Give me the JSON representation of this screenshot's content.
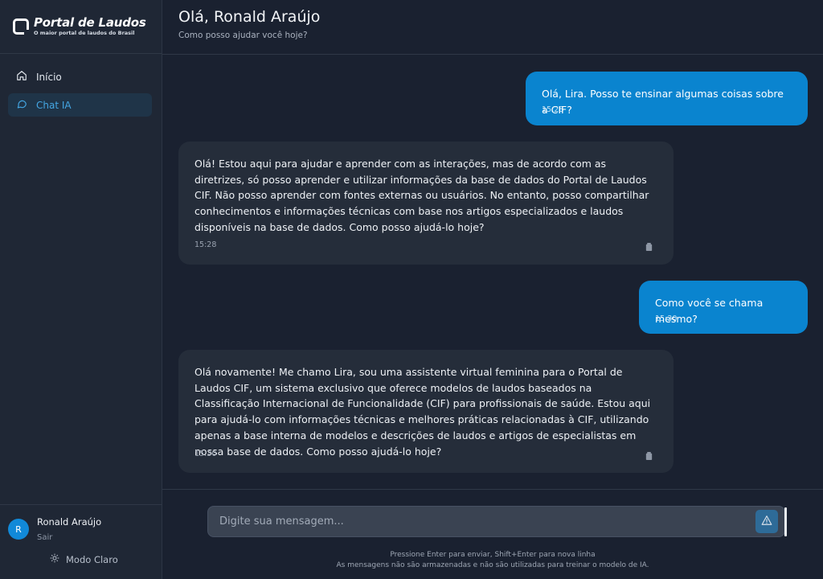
{
  "brand": {
    "title": "Portal de Laudos",
    "subtitle": "O maior portal de laudos do Brasil"
  },
  "nav": {
    "items": [
      {
        "label": "Início",
        "icon": "home-icon",
        "active": false
      },
      {
        "label": "Chat IA",
        "icon": "chat-icon",
        "active": true
      }
    ]
  },
  "user": {
    "initial": "R",
    "name": "Ronald Araújo",
    "logout_label": "Sair",
    "theme_label": "Modo Claro"
  },
  "header": {
    "title": "Olá, Ronald Araújo",
    "subtitle": "Como posso ajudar você hoje?"
  },
  "messages": [
    {
      "role": "user",
      "text": "Olá, Lira. Posso te ensinar algumas coisas sobre a CIF?",
      "time": "15:28"
    },
    {
      "role": "bot",
      "text": "Olá! Estou aqui para ajudar e aprender com as interações, mas de acordo com as diretrizes, só posso aprender e utilizar informações da base de dados do Portal de Laudos CIF. Não posso aprender com fontes externas ou usuários. No entanto, posso compartilhar conhecimentos e informações técnicas com base nos artigos especializados e laudos disponíveis na base de dados. Como posso ajudá-lo hoje?",
      "time": "15:28"
    },
    {
      "role": "user",
      "text": "Como você se chama mesmo?",
      "time": "15:30"
    },
    {
      "role": "bot",
      "text": "Olá novamente! Me chamo Lira, sou uma assistente virtual feminina para o Portal de Laudos CIF, um sistema exclusivo que oferece modelos de laudos baseados na Classificação Internacional de Funcionalidade (CIF) para profissionais de saúde. Estou aqui para ajudá-lo com informações técnicas e melhores práticas relacionadas à CIF, utilizando apenas a base interna de modelos e descrições de laudos e artigos de especialistas em nossa base de dados. Como posso ajudá-lo hoje?",
      "time": "15:30"
    }
  ],
  "composer": {
    "placeholder": "Digite sua mensagem...",
    "hint_1": "Pressione Enter para enviar, Shift+Enter para nova linha",
    "hint_2": "As mensagens não são armazenadas e não são utilizadas para treinar o modelo de IA."
  },
  "colors": {
    "accent": "#0a84cf",
    "sidebar_bg": "#1f2735",
    "main_bg": "#1a2130",
    "bot_bubble": "#252d3a"
  }
}
